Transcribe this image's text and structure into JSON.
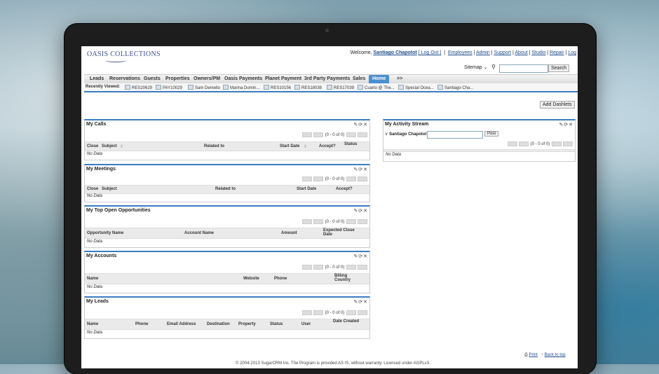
{
  "header": {
    "logo": "OASIS COLLECTIONS",
    "welcome_prefix": "Welcome,",
    "user": "Santiago Chapotot",
    "logout": "[ Log Out ]",
    "links": [
      "Employees",
      "Admin",
      "Support",
      "About",
      "Studio",
      "Repair",
      "Log"
    ],
    "sitemap": "Sitemap",
    "search_button": "Search",
    "search_value": ""
  },
  "nav": {
    "tabs": [
      "Leads",
      "Reservations",
      "Guests",
      "Properties",
      "Owners/PM",
      "Oasis Payments",
      "Planet Payment",
      "3rd Party Payments",
      "Sales",
      "Home",
      ">>"
    ]
  },
  "recent": {
    "label": "Recently Viewed:",
    "items": [
      "RES20629",
      "PAY10029",
      "Sam Demello",
      "Marina Domin...",
      "RES10156",
      "RES18038",
      "RES17039",
      "Cuarto @ The...",
      "Special Ocea...",
      "Santiago Cha..."
    ]
  },
  "add_dashlets": "Add Dashlets",
  "pager_text": "(0 - 0 of 0)",
  "no_data": "No Data",
  "dashlets": {
    "calls": {
      "title": "My Calls",
      "cols": [
        "Close",
        "Subject",
        "Related to",
        "Start Date",
        "Accept?",
        "Status"
      ]
    },
    "meetings": {
      "title": "My Meetings",
      "cols": [
        "Close",
        "Subject",
        "Related to",
        "Start Date",
        "Accept?"
      ]
    },
    "opps": {
      "title": "My Top Open Opportunities",
      "cols": [
        "Opportunity Name",
        "Account Name",
        "Amount",
        "Expected Close Date"
      ]
    },
    "accounts": {
      "title": "My Accounts",
      "cols": [
        "Name",
        "Website",
        "Phone",
        "Billing Country"
      ]
    },
    "leads": {
      "title": "My Leads",
      "cols": [
        "Name",
        "Phone",
        "Email Address",
        "Destination",
        "Property",
        "Status",
        "User",
        "Date Created"
      ]
    },
    "activity": {
      "title": "My Activity Stream",
      "user": "Santiago Chapotot",
      "post": "Post"
    }
  },
  "footer": {
    "print": "Print",
    "back_to_top": "Back to top",
    "copyright": "© 2004-2013 SugarCRM Inc. The Program is provided AS IS, without warranty. Licensed under AGPLv3."
  }
}
